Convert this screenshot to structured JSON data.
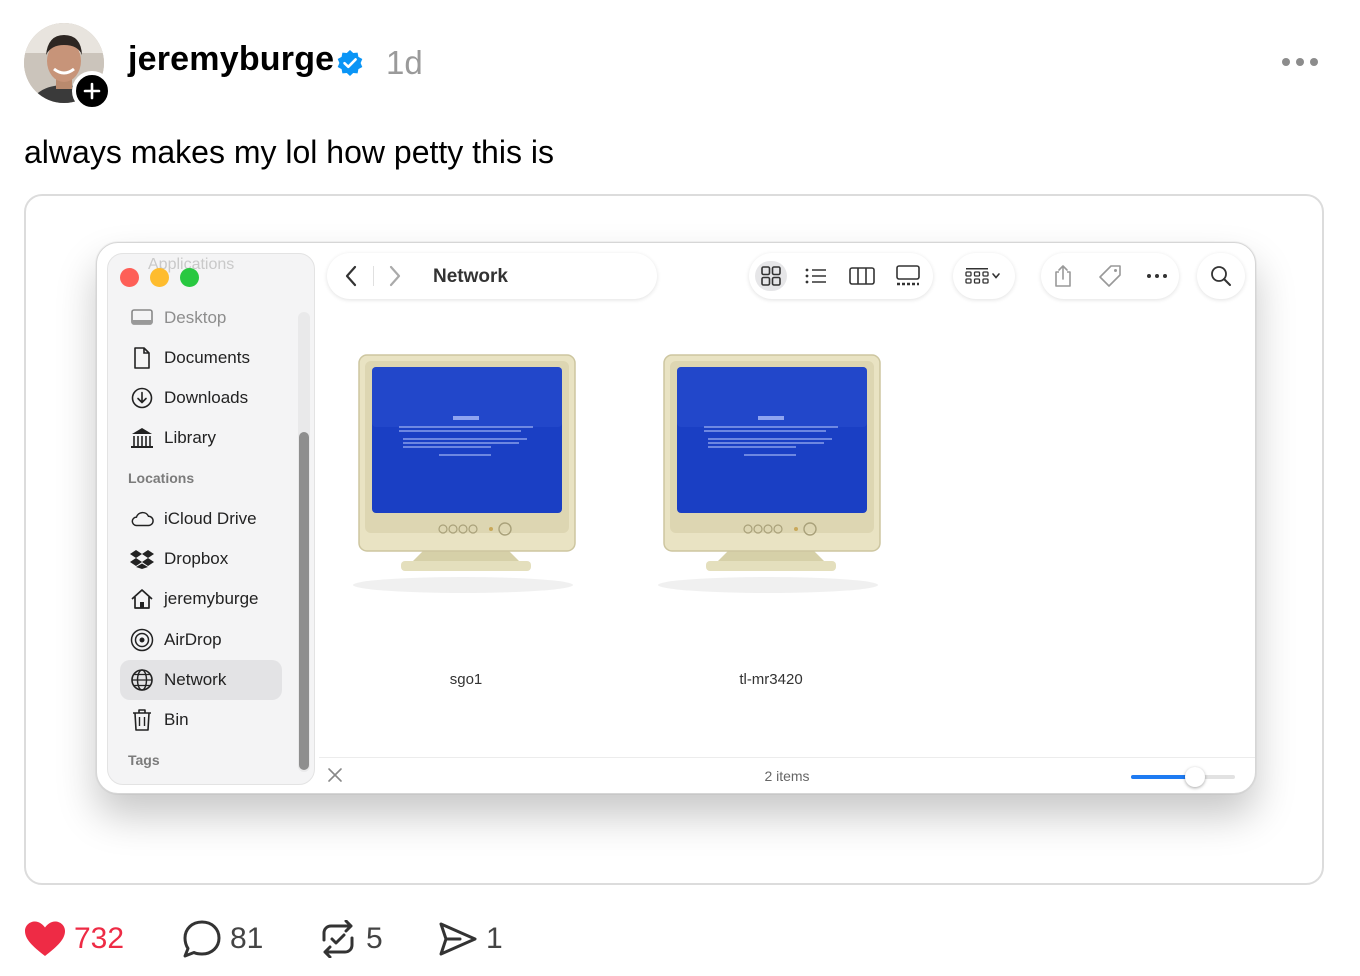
{
  "post": {
    "username": "jeremyburge",
    "time": "1d",
    "text": "always makes my lol how petty this is"
  },
  "finder": {
    "ghost_heading": "Applications",
    "sidebar": {
      "items_top": [
        {
          "label": "Desktop",
          "icon": "desktop-icon"
        },
        {
          "label": "Documents",
          "icon": "document-icon"
        },
        {
          "label": "Downloads",
          "icon": "download-icon"
        },
        {
          "label": "Library",
          "icon": "library-icon"
        }
      ],
      "locations_heading": "Locations",
      "locations": [
        {
          "label": "iCloud Drive",
          "icon": "cloud-icon"
        },
        {
          "label": "Dropbox",
          "icon": "dropbox-icon"
        },
        {
          "label": "jeremyburge",
          "icon": "home-icon"
        },
        {
          "label": "AirDrop",
          "icon": "airdrop-icon"
        },
        {
          "label": "Network",
          "icon": "network-icon",
          "selected": true
        },
        {
          "label": "Bin",
          "icon": "trash-icon"
        }
      ],
      "tags_heading": "Tags"
    },
    "title": "Network",
    "files": [
      {
        "name": "sgo1",
        "icon": "crt-monitor-bsod-icon"
      },
      {
        "name": "tl-mr3420",
        "icon": "crt-monitor-bsod-icon"
      }
    ],
    "status": "2 items",
    "zoom_level": 0.62,
    "colors": {
      "close": "#fe5f57",
      "minimize": "#febc2e",
      "zoom": "#28c840",
      "accent": "#1e7bf2",
      "screen": "#1a3fc4"
    }
  },
  "engagement": {
    "likes": "732",
    "comments": "81",
    "reposts": "5",
    "shares": "1",
    "like_color": "#ee2b45"
  }
}
